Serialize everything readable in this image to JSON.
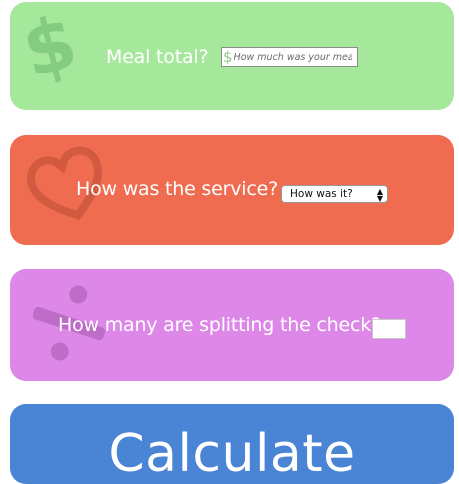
{
  "meal": {
    "label": "Meal total?",
    "currency_prefix": "$",
    "placeholder": "How much was your meal?",
    "icon": "dollar-icon"
  },
  "service": {
    "label": "How was the service?",
    "selected": "How was it?",
    "icon": "heart-icon"
  },
  "split": {
    "label": "How many are splitting the check?",
    "value": "",
    "icon": "divide-icon"
  },
  "calculate": {
    "label": "Calculate"
  },
  "colors": {
    "meal_card": "#a6e89b",
    "service_card": "#ef6c50",
    "split_card": "#dd88e8",
    "calculate_card": "#4a84d4"
  }
}
